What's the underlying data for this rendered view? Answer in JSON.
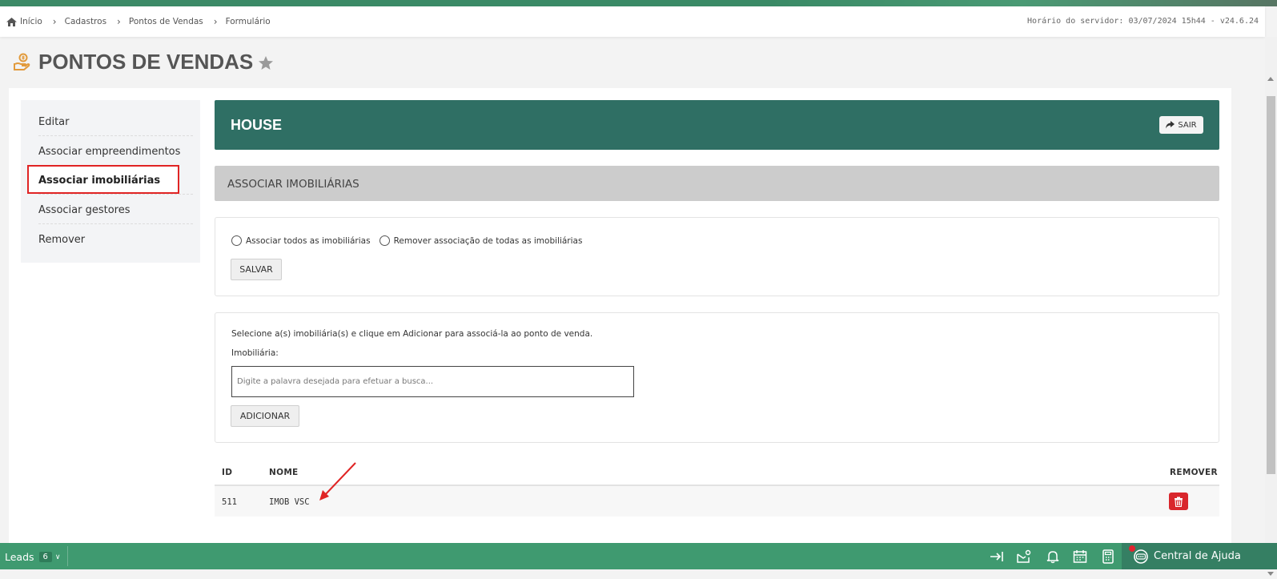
{
  "breadcrumb": {
    "items": [
      "Início",
      "Cadastros",
      "Pontos de Vendas",
      "Formulário"
    ]
  },
  "server_time": "Horário do servidor: 03/07/2024 15h44 - v24.6.24",
  "page": {
    "title": "PONTOS DE VENDAS"
  },
  "sidebar": {
    "items": [
      {
        "label": "Editar"
      },
      {
        "label": "Associar empreendimentos"
      },
      {
        "label": "Associar imobiliárias",
        "active": true
      },
      {
        "label": "Associar gestores"
      },
      {
        "label": "Remover"
      }
    ]
  },
  "header_bar": {
    "title": "HOUSE",
    "exit_label": "SAIR"
  },
  "section": {
    "title": "ASSOCIAR IMOBILIÁRIAS"
  },
  "bulk": {
    "option_all": "Associar todos as imobiliárias",
    "option_remove": "Remover associação de todas as imobiliárias",
    "save_label": "SALVAR"
  },
  "add": {
    "instruction": "Selecione a(s) imobiliária(s) e clique em Adicionar para associá-la ao ponto de venda.",
    "field_label": "Imobiliária:",
    "placeholder": "Digite a palavra desejada para efetuar a busca...",
    "add_label": "ADICIONAR"
  },
  "table": {
    "headers": {
      "id": "ID",
      "name": "NOME",
      "remove": "REMOVER"
    },
    "rows": [
      {
        "id": "511",
        "name": "IMOB VSC"
      }
    ]
  },
  "footer": {
    "leads_label": "Leads",
    "leads_count": "6",
    "help_label": "Central de Ajuda"
  },
  "colors": {
    "brand_dark": "#2f6f64",
    "footer_green": "#3f9a70",
    "highlight_red": "#e02424",
    "danger": "#d9262c"
  }
}
